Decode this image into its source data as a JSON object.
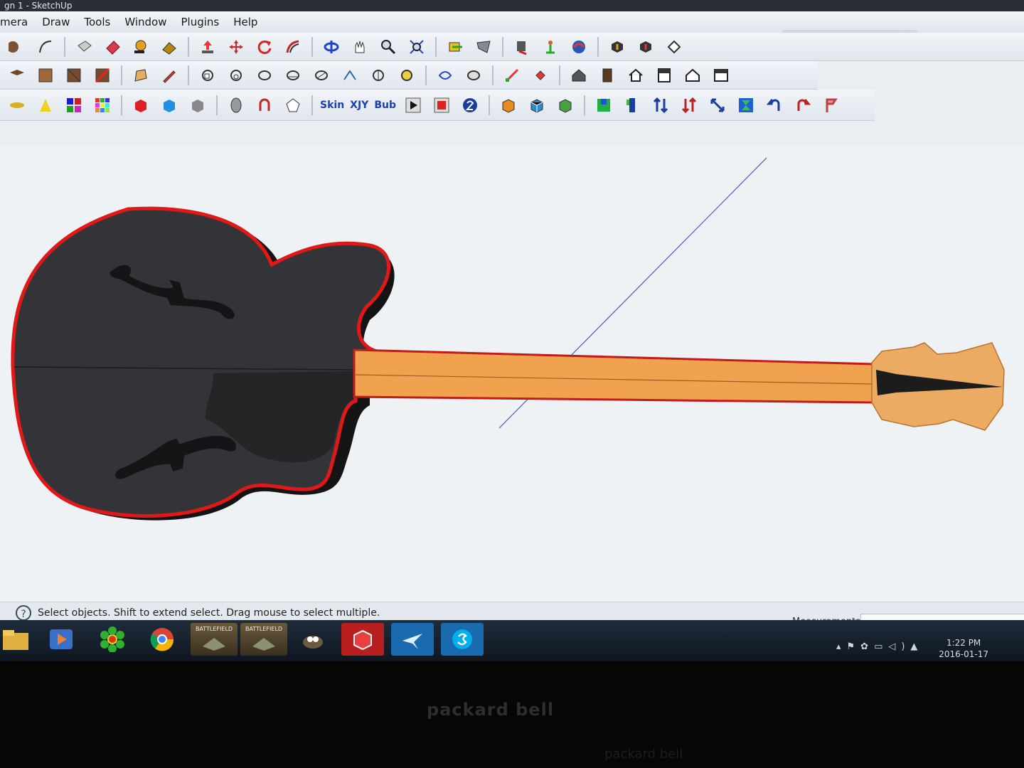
{
  "window": {
    "title": "gn 1 - SketchUp"
  },
  "menu": [
    "mera",
    "Draw",
    "Tools",
    "Window",
    "Plugins",
    "Help"
  ],
  "toolbars": {
    "rowA": [
      "circle-icon",
      "arc-icon",
      "eraser-box-icon",
      "paint-bucket-icon",
      "tape-measure-icon",
      "paint-roller-icon",
      "push-pull-icon",
      "move-icon",
      "rotate-icon",
      "follow-me-icon",
      "orbit-icon",
      "pan-icon",
      "zoom-icon",
      "zoom-extents-icon",
      "section-icon",
      "previous-view-icon",
      "walk-icon",
      "position-camera-icon",
      "look-around-icon",
      "get-models-icon",
      "share-model-icon",
      "component-icon"
    ],
    "rowB": [
      "layers-icon",
      "texture-icon",
      "material-icon",
      "delete-material-icon",
      "shape-icon",
      "pencil-icon",
      "tool-1-icon",
      "tool-2-icon",
      "tool-3-icon",
      "tool-4-icon",
      "tool-5-icon",
      "tool-6-icon",
      "tool-7-icon",
      "tool-8-icon",
      "tool-9-icon",
      "tool-10-icon",
      "tool-11-icon",
      "tool-12-icon",
      "house-icon",
      "door-icon",
      "home-icon",
      "window-icon",
      "roof-icon",
      "wall-icon"
    ],
    "rowC": {
      "icons_left": [
        "axes-icon",
        "cone-icon",
        "palette-icon",
        "grid-colors-icon",
        "red-cube-icon",
        "blue-cube-icon",
        "grey-cube-icon",
        "barrel-icon",
        "magnet-icon",
        "polyhedron-icon"
      ],
      "text_buttons": [
        "Skin",
        "XJY",
        "Bub"
      ],
      "icons_right": [
        "play-icon",
        "stop-icon",
        "number-two-icon",
        "orange-cube-icon",
        "sliced-cube-icon",
        "green-cube-icon",
        "texture-cube-icon",
        "flag-icon",
        "swap-arrows-icon",
        "down-up-arrows-icon",
        "scale-arrow-icon",
        "hourglass-icon",
        "undo-arrow-icon",
        "redo-arrow-icon",
        "red-flag-icon"
      ]
    }
  },
  "status": {
    "help_symbol": "?",
    "text": "Select objects. Shift to extend select. Drag mouse to select multiple.",
    "measurements_label": "Measurements",
    "measurements_value": ""
  },
  "taskbar": {
    "items": [
      "folder-icon",
      "media-player-icon",
      "icq-icon",
      "chrome-icon",
      "battlefield-icon",
      "battlefield-icon",
      "gimp-icon",
      "sketchup-icon",
      "flight-icon",
      "skype-icon"
    ],
    "battlefield_label": "BATTLEFIELD",
    "clock_time": "1:22 PM",
    "clock_date": "2016-01-17"
  },
  "bezel": {
    "brand": "packard bell",
    "brand_lower": "packard bell"
  },
  "colors": {
    "guitar_body": "#333437",
    "guitar_body_shadow": "#141414",
    "guitar_outline": "#e01818",
    "neck": "#f0a24f",
    "headstock": "#ecab63",
    "canvas": "#eef2f5"
  }
}
